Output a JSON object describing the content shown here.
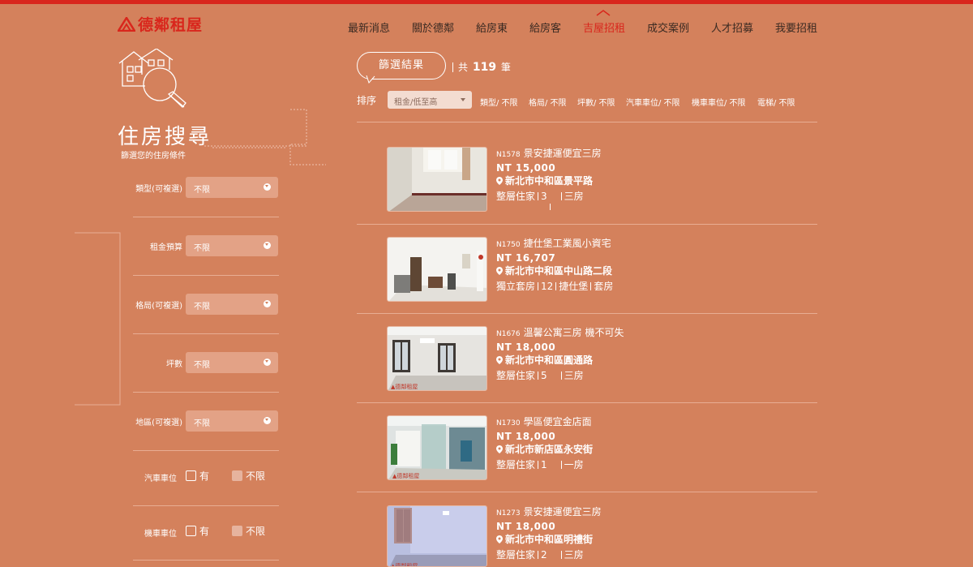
{
  "header": {
    "logo_text": "德鄰租屋",
    "nav": [
      "最新消息",
      "關於德鄰",
      "給房東",
      "給房客",
      "吉屋招租",
      "成交案例",
      "人才招募",
      "我要招租"
    ],
    "active_index": 4
  },
  "sidebar": {
    "title": "住房搜尋",
    "subtitle": "篩選您的住房條件",
    "filters": [
      {
        "label": "類型(可複選)",
        "value": "不限"
      },
      {
        "label": "租金預算",
        "value": "不限"
      },
      {
        "label": "格局(可複選)",
        "value": "不限"
      },
      {
        "label": "坪數",
        "value": "不限"
      },
      {
        "label": "地區(可複選)",
        "value": "不限"
      }
    ],
    "checks": [
      {
        "label": "汽車車位",
        "opt1": "有",
        "opt2": "不限"
      },
      {
        "label": "機車車位",
        "opt1": "有",
        "opt2": "不限"
      }
    ]
  },
  "results": {
    "title": "篩選結果",
    "count_prefix": "共",
    "count": "119",
    "count_suffix": "筆",
    "sort_label": "排序",
    "sort_value": "租金/低至高",
    "chips": [
      "類型/ 不限",
      "格局/ 不限",
      "坪數/ 不限",
      "汽車車位/ 不限",
      "機車車位/ 不限",
      "電梯/ 不限"
    ]
  },
  "listings": [
    {
      "code": "N1578",
      "title": "景安捷運便宜三房",
      "price": "NT 15,000",
      "address": "新北市中和區景平路",
      "tag1": "整層住家",
      "tag2": "3",
      "tag3": "三房"
    },
    {
      "code": "N1750",
      "title": "捷仕堡工業風小資宅",
      "price": "NT 16,707",
      "address": "新北市中和區中山路二段",
      "tag1": "獨立套房",
      "tag2": "12",
      "tag3": "捷仕堡",
      "tag4": "套房"
    },
    {
      "code": "N1676",
      "title": "溫馨公寓三房 機不可失",
      "price": "NT 18,000",
      "address": "新北市中和區圓通路",
      "tag1": "整層住家",
      "tag2": "5",
      "tag3": "三房"
    },
    {
      "code": "N1730",
      "title": "學區便宜金店面",
      "price": "NT 18,000",
      "address": "新北市新店區永安街",
      "tag1": "整層住家",
      "tag2": "1",
      "tag3": "一房"
    },
    {
      "code": "N1273",
      "title": "景安捷運便宜三房",
      "price": "NT 18,000",
      "address": "新北市中和區明禮街",
      "tag1": "整層住家",
      "tag2": "2",
      "tag3": "三房"
    }
  ]
}
